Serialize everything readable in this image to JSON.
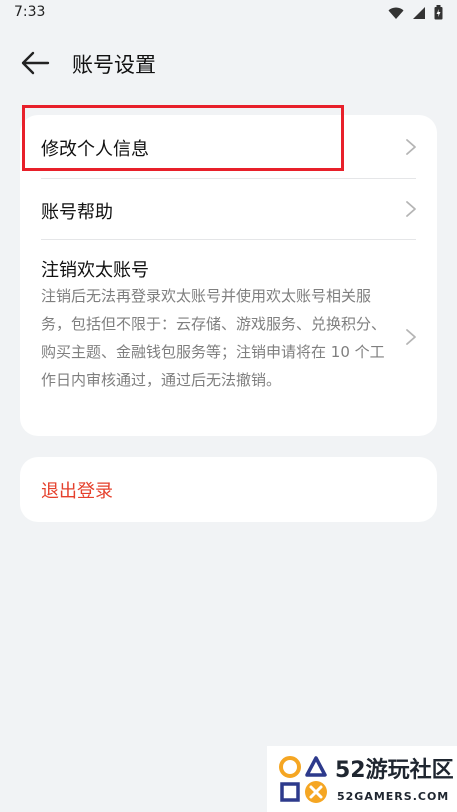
{
  "status_bar": {
    "time": "7:33"
  },
  "header": {
    "title": "账号设置"
  },
  "settings": {
    "items": [
      {
        "label": "修改个人信息"
      },
      {
        "label": "账号帮助"
      },
      {
        "label": "注销欢太账号",
        "description": "注销后无法再登录欢太账号并使用欢太账号相关服务，包括但不限于：云存储、游戏服务、兑换积分、购买主题、金融钱包服务等；注销申请将在 10 个工作日内审核通过，通过后无法撤销。"
      }
    ]
  },
  "logout": {
    "label": "退出登录"
  },
  "watermark": {
    "brand": "52游玩社区",
    "site": "52GAMERS.COM"
  },
  "colors": {
    "background": "#f1f3f5",
    "card": "#ffffff",
    "logout_text": "#e5402c",
    "highlight_border": "#e8202a",
    "secondary_text": "#7f7f7f"
  },
  "icons": [
    "wifi-icon",
    "signal-icon",
    "battery-icon",
    "back-arrow-icon",
    "chevron-right-icon"
  ]
}
